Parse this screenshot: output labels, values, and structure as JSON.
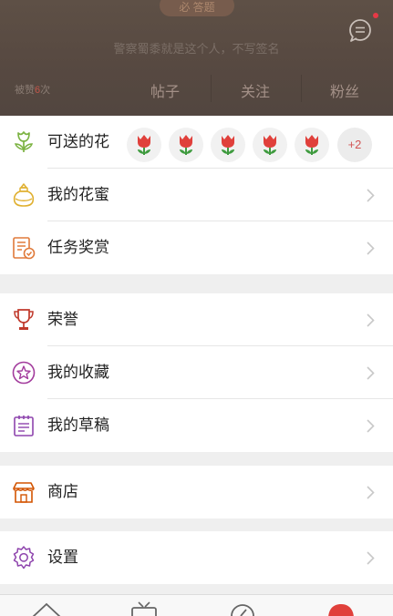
{
  "header": {
    "top_badge": "必 答题",
    "signature": "警察蜀黍就是这个人，不写签名",
    "likes_prefix": "被赞",
    "likes_count": "6",
    "likes_suffix": "次",
    "stats": [
      "帖子",
      "关注",
      "粉丝"
    ]
  },
  "flowers_row": {
    "label": "可送的花",
    "flower_count": 5,
    "more": "+2"
  },
  "group1": [
    {
      "label": "我的花蜜",
      "icon": "honey-jar-icon"
    },
    {
      "label": "任务奖赏",
      "icon": "task-reward-icon"
    }
  ],
  "group2": [
    {
      "label": "荣誉",
      "icon": "trophy-icon"
    },
    {
      "label": "我的收藏",
      "icon": "star-circle-icon"
    },
    {
      "label": "我的草稿",
      "icon": "draft-icon"
    }
  ],
  "group3": [
    {
      "label": "商店",
      "icon": "shop-icon"
    }
  ],
  "group4": [
    {
      "label": "设置",
      "icon": "gear-icon"
    }
  ],
  "colors": {
    "header": "#574941",
    "flower": "#e0403b",
    "chevron": "#c8c8c8"
  }
}
